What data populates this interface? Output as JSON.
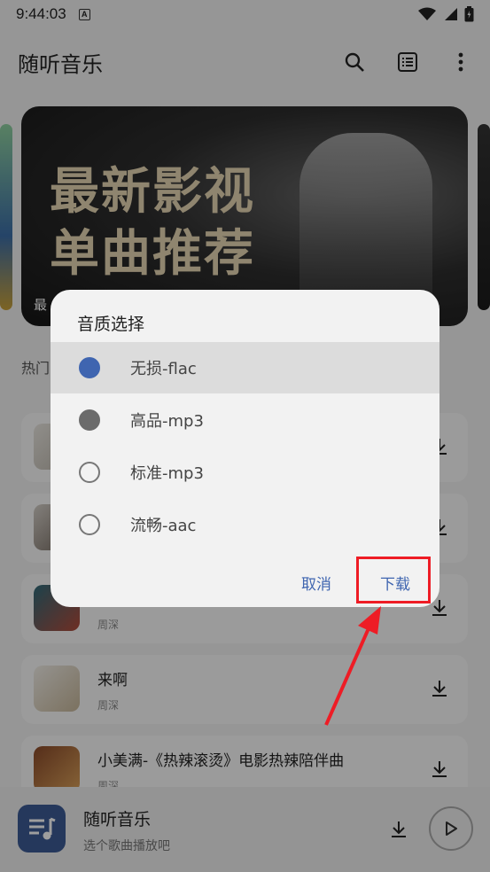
{
  "status_bar": {
    "time": "9:44:03",
    "badge": "A"
  },
  "app_bar": {
    "title": "随听音乐"
  },
  "banner": {
    "headline_line1": "最新影视",
    "headline_line2": "单曲推荐",
    "caption": "最"
  },
  "section": {
    "label": "热门"
  },
  "songs": [
    {
      "name": "",
      "artist": ""
    },
    {
      "name": "",
      "artist": ""
    },
    {
      "name": "",
      "artist": "周深"
    },
    {
      "name": "来啊",
      "artist": "周深"
    },
    {
      "name": "小美满-《热辣滚烫》电影热辣陪伴曲",
      "artist": "周深"
    }
  ],
  "player": {
    "title": "随听音乐",
    "subtitle": "选个歌曲播放吧"
  },
  "dialog": {
    "title": "音质选择",
    "options": [
      {
        "label": "无损-flac",
        "state": "selected"
      },
      {
        "label": "高品-mp3",
        "state": "filled"
      },
      {
        "label": "标准-mp3",
        "state": "empty"
      },
      {
        "label": "流畅-aac",
        "state": "empty"
      }
    ],
    "cancel_label": "取消",
    "download_label": "下载"
  },
  "colors": {
    "accent": "#3f65b0",
    "highlight": "#ee1c25",
    "logo_bg": "#3c5b95"
  },
  "icons": [
    "search-icon",
    "list-icon",
    "more-vert-icon",
    "download-icon",
    "play-icon",
    "music-note-icon",
    "wifi-icon",
    "signal-icon",
    "battery-icon"
  ]
}
